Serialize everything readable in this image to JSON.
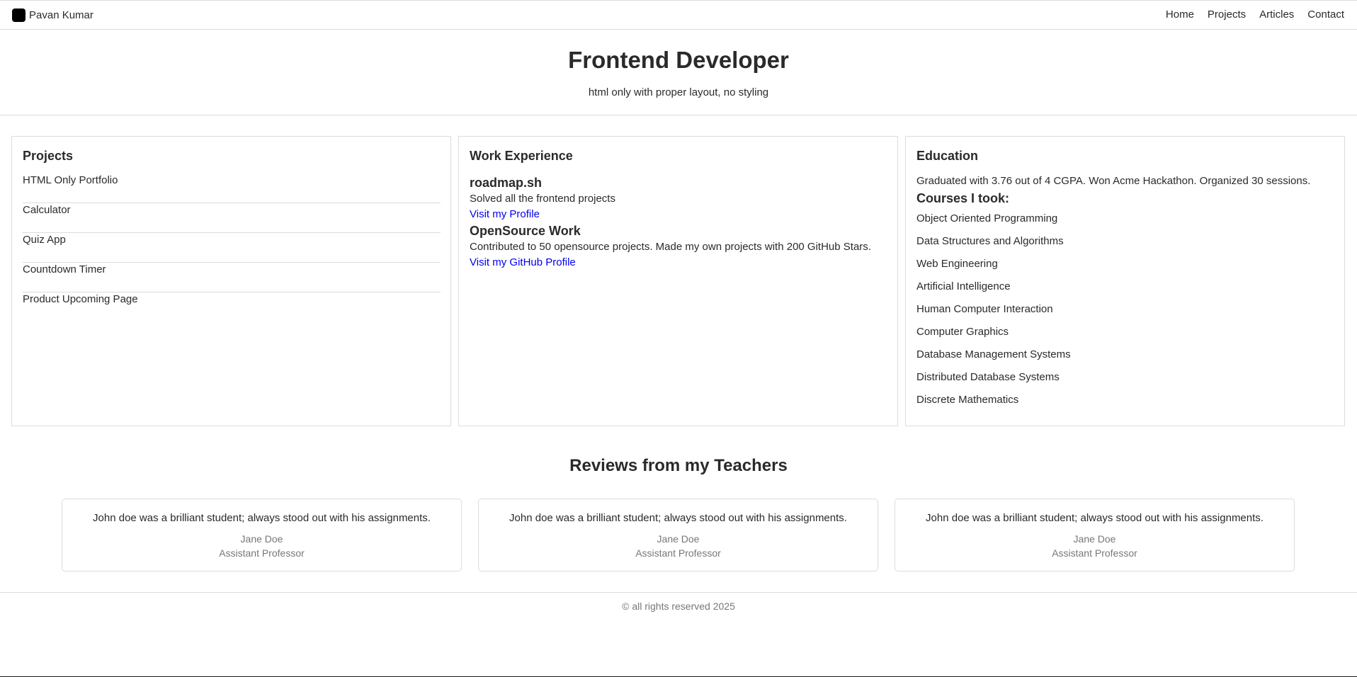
{
  "brand": {
    "name": "Pavan Kumar"
  },
  "nav": {
    "links": [
      "Home",
      "Projects",
      "Articles",
      "Contact"
    ]
  },
  "hero": {
    "title": "Frontend Developer",
    "subtitle": "html only with proper layout, no styling"
  },
  "projects": {
    "heading": "Projects",
    "items": [
      "HTML Only Portfolio",
      "Calculator",
      "Quiz App",
      "Countdown Timer",
      "Product Upcoming Page"
    ]
  },
  "work": {
    "heading": "Work Experience",
    "entries": [
      {
        "title": "roadmap.sh",
        "description": "Solved all the frontend projects",
        "link": "Visit my Profile"
      },
      {
        "title": "OpenSource Work",
        "description": "Contributed to 50 opensource projects. Made my own projects with 200 GitHub Stars.",
        "link": "Visit my GitHub Profile"
      }
    ]
  },
  "education": {
    "heading": "Education",
    "summary": "Graduated with 3.76 out of 4 CGPA. Won Acme Hackathon. Organized 30 sessions.",
    "courses_heading": "Courses I took:",
    "courses": [
      "Object Oriented Programming",
      "Data Structures and Algorithms",
      "Web Engineering",
      "Artificial Intelligence",
      "Human Computer Interaction",
      "Computer Graphics",
      "Database Management Systems",
      "Distributed Database Systems",
      "Discrete Mathematics"
    ]
  },
  "reviews": {
    "heading": "Reviews from my Teachers",
    "items": [
      {
        "quote": "John doe was a brilliant student; always stood out with his assignments.",
        "name": "Jane Doe",
        "role": "Assistant Professor"
      },
      {
        "quote": "John doe was a brilliant student; always stood out with his assignments.",
        "name": "Jane Doe",
        "role": "Assistant Professor"
      },
      {
        "quote": "John doe was a brilliant student; always stood out with his assignments.",
        "name": "Jane Doe",
        "role": "Assistant Professor"
      }
    ]
  },
  "footer": {
    "text": "© all rights reserved 2025"
  }
}
